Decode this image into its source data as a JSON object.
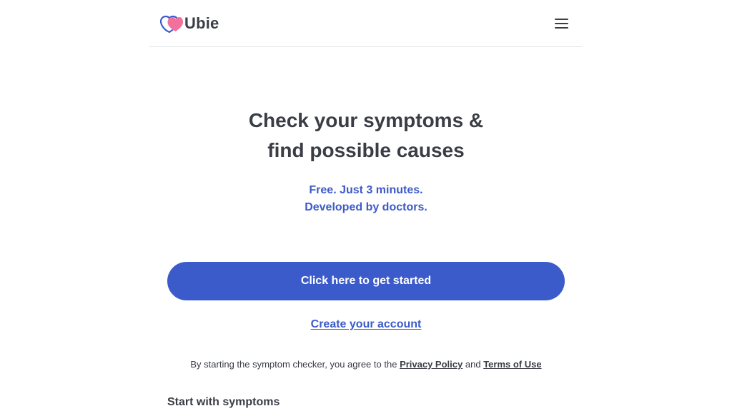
{
  "header": {
    "logo_text": "Ubie",
    "logo_icon": "heart-logo-icon",
    "menu_icon": "hamburger-menu-icon"
  },
  "hero": {
    "title_line1": "Check your symptoms &",
    "title_line2": "find possible causes",
    "subtitle_line1": "Free. Just 3 minutes.",
    "subtitle_line2": "Developed by doctors."
  },
  "actions": {
    "get_started_label": "Click here to get started",
    "create_account_label": "Create your account"
  },
  "consent": {
    "prefix": "By starting the symptom checker, you agree to the",
    "privacy_policy": "Privacy Policy",
    "and": "and",
    "terms_of_use": "Terms of Use"
  },
  "sections": {
    "start_with_symptoms": "Start with symptoms"
  },
  "colors": {
    "accent": "#3b5bcb",
    "text": "#3a3d45",
    "logo_pink": "#f2719c",
    "logo_blue": "#3b5bcb"
  }
}
